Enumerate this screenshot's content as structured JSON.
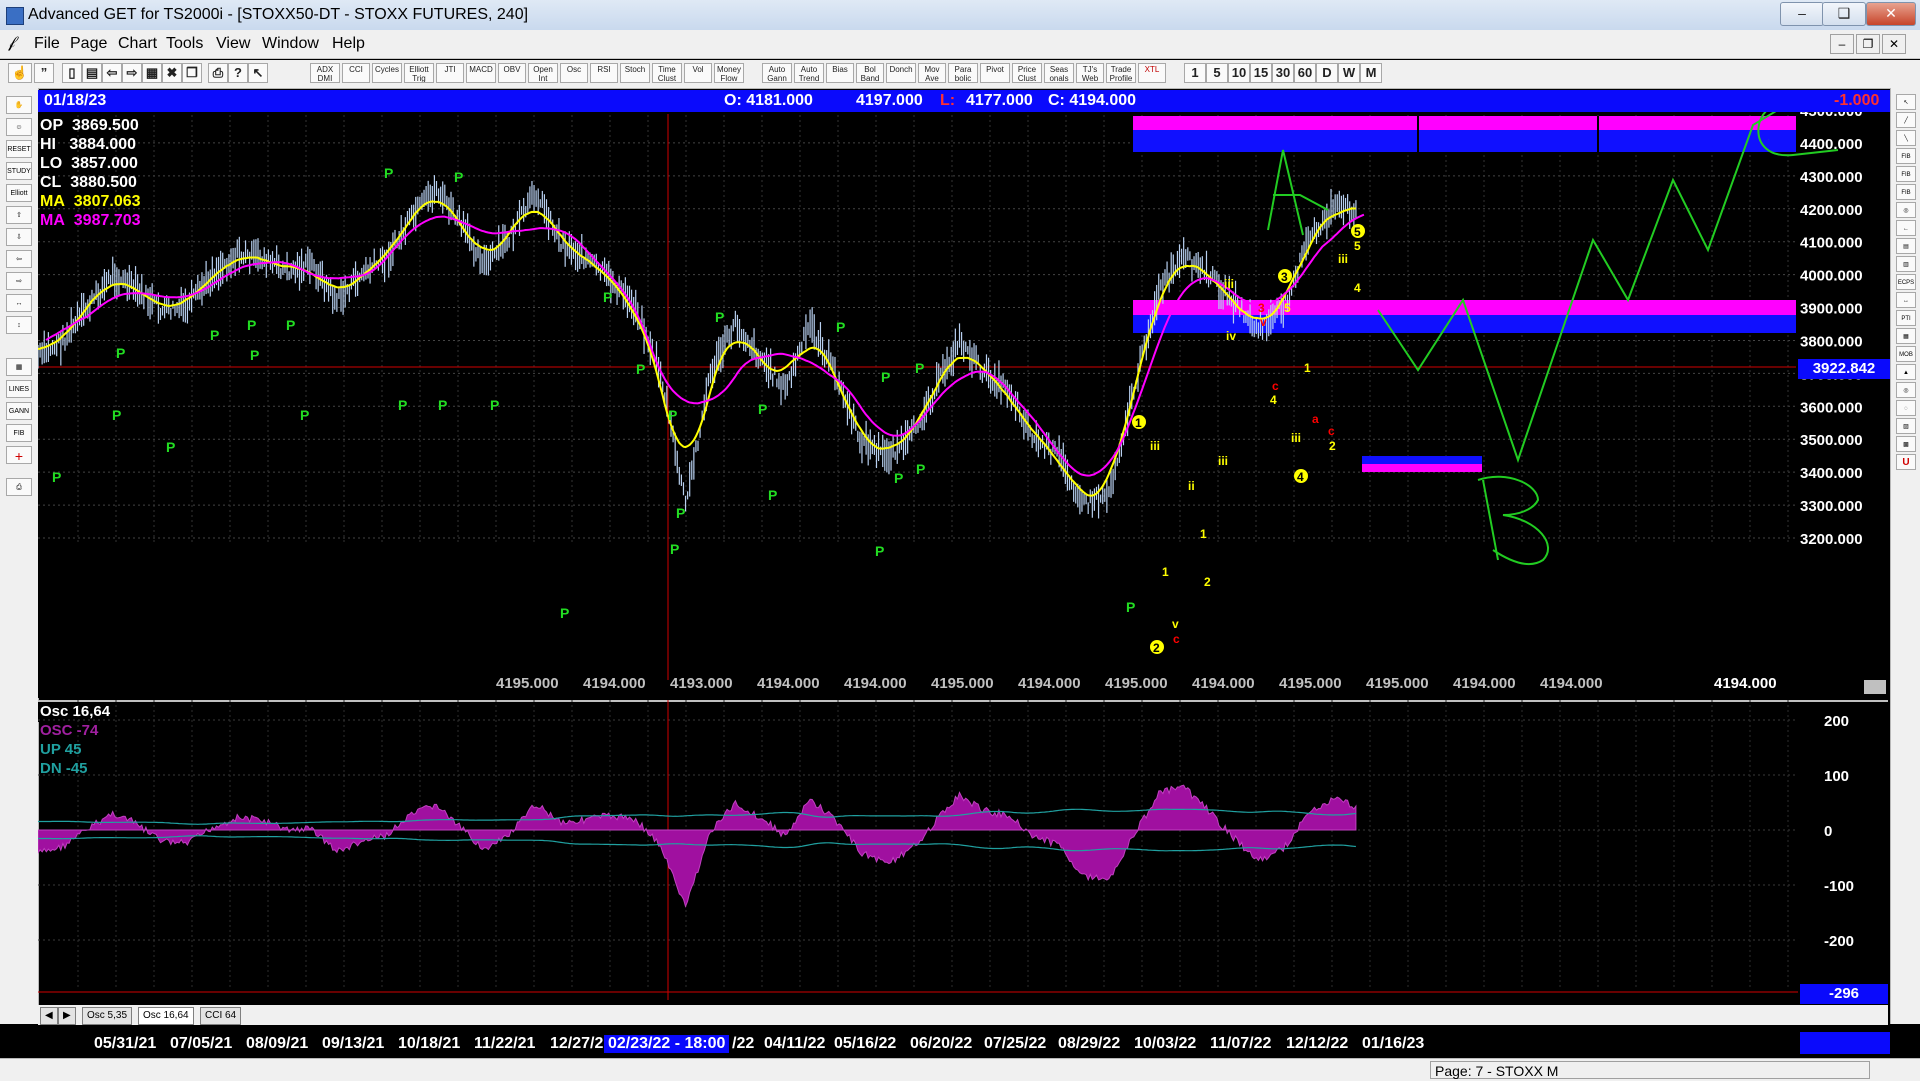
{
  "window": {
    "title": "Advanced GET for TS2000i - [STOXX50-DT - STOXX FUTURES, 240]",
    "min": "–",
    "max": "❑",
    "close": "✕",
    "mdi_min": "–",
    "mdi_restore": "❐",
    "mdi_close": "✕"
  },
  "menu": [
    "File",
    "Page",
    "Chart",
    "Tools",
    "View",
    "Window",
    "Help"
  ],
  "toolbar": {
    "studies": [
      "ADX DMI",
      "CCI",
      "Cycles",
      "Elliott Trig",
      "JTI",
      "MACD",
      "OBV",
      "Open Int",
      "Osc",
      "RSI",
      "Stoch",
      "Time Clust",
      "Vol",
      "Money Flow",
      "Auto Gann",
      "Auto Trend",
      "Bias",
      "Bol Band",
      "Donch",
      "Mov Ave",
      "Para bolic",
      "Pivot",
      "Price Clust",
      "Seas onals",
      "TJ's Web",
      "Trade Profile",
      "XTL"
    ],
    "timeframes": [
      "1",
      "5",
      "10",
      "15",
      "30",
      "60",
      "D",
      "W",
      "M"
    ]
  },
  "left_tools": [
    "✋",
    "☺",
    "RESET",
    "STUDY",
    "Elliott",
    "⇧",
    "⇩",
    "⇦",
    "⇨",
    "↔",
    "↕",
    "▦",
    "LINES",
    "GANN",
    "FIB",
    "+",
    "⎙"
  ],
  "right_tools": [
    "↖",
    "╱",
    "╲",
    "FIB RET",
    "FIB EXT",
    "FIB TIME",
    "◎",
    "←",
    "▤",
    "▥",
    "ECPS",
    "↔",
    "PTI",
    "▦",
    "MOB",
    "▲",
    "◎",
    "◌",
    "▨",
    "▩",
    "U"
  ],
  "chart": {
    "date": "01/18/23",
    "open_label": "O: 4181.000",
    "high_label": "4197.000",
    "low_label": "L:",
    "low_value": "4177.000",
    "close_label": "C: 4194.000",
    "change": "-1.000",
    "stats": [
      {
        "label": "OP",
        "value": "3869.500",
        "color": "#ffffff"
      },
      {
        "label": "HI",
        "value": "3884.000",
        "color": "#ffffff"
      },
      {
        "label": "LO",
        "value": "3857.000",
        "color": "#ffffff"
      },
      {
        "label": "CL",
        "value": "3880.500",
        "color": "#ffffff"
      },
      {
        "label": "MA",
        "value": "3807.063",
        "color": "#ffff00"
      },
      {
        "label": "MA",
        "value": "3987.703",
        "color": "#ff00ff"
      }
    ],
    "current_price": "3922.842",
    "y_axis": [
      "4500.000",
      "4400.000",
      "4300.000",
      "4200.000",
      "4100.000",
      "4000.000",
      "3900.000",
      "3800.000",
      "3700.000",
      "3600.000",
      "3500.000",
      "3400.000",
      "3300.000",
      "3200.000"
    ],
    "bottom_values": [
      "4194.000",
      "4195.000",
      "4195.000",
      "4194.000",
      "4193.000",
      "4194.000",
      "4194.000",
      "4195.000",
      "4194.000",
      "4195.000",
      "4194.000",
      "4195.000",
      "4195.000",
      "4194.000",
      "4194.000"
    ]
  },
  "chart_data": {
    "type": "line",
    "series": [
      {
        "values": [
          3750,
          3800,
          3900,
          4000,
          3950,
          3890,
          3900,
          4000,
          4060,
          4050,
          4010,
          4030,
          3920,
          4000,
          4050,
          4170,
          4260,
          4150,
          4030,
          4120,
          4250,
          4100,
          4050,
          3980,
          3900,
          3700,
          3300,
          3700,
          3850,
          3750,
          3650,
          3850,
          3700,
          3500,
          3450,
          3500,
          3650,
          3800,
          3700,
          3650,
          3500,
          3450,
          3300,
          3340,
          3650,
          3950,
          4050,
          4000,
          3920,
          3830,
          3900,
          4100,
          4200,
          4197
        ]
      }
    ],
    "y_range": [
      3200,
      4500
    ],
    "pivots_p": 30,
    "current_price": 3922.842
  },
  "osc": {
    "title": "Osc 16,64",
    "osc_label": "OSC -74",
    "up_label": "UP   45",
    "dn_label": "DN   -45",
    "y_axis": [
      "200",
      "100",
      "0",
      "-100",
      "-200"
    ],
    "current": "-296"
  },
  "tabs": [
    "Osc 5,35",
    "Osc 16,64",
    "CCI 64"
  ],
  "tab_nav": [
    "◀",
    "▶"
  ],
  "dates": [
    "05/31/21",
    "07/05/21",
    "08/09/21",
    "09/13/21",
    "10/18/21",
    "11/22/21",
    "12/27/2",
    "02/23/22 - 18:00",
    "/22",
    "04/11/22",
    "05/16/22",
    "06/20/22",
    "07/25/22",
    "08/29/22",
    "10/03/22",
    "11/07/22",
    "12/12/22",
    "01/16/23"
  ],
  "status": "Page: 7 - STOXX M",
  "annotations": {
    "wave_A": "A",
    "wave_B": "B",
    "wave_C": "C",
    "pivot": "P",
    "roman": [
      "i",
      "ii",
      "iii",
      "iv",
      "v"
    ],
    "numbers": [
      "1",
      "2",
      "3",
      "4",
      "5"
    ],
    "letters": [
      "a",
      "b",
      "c"
    ]
  }
}
